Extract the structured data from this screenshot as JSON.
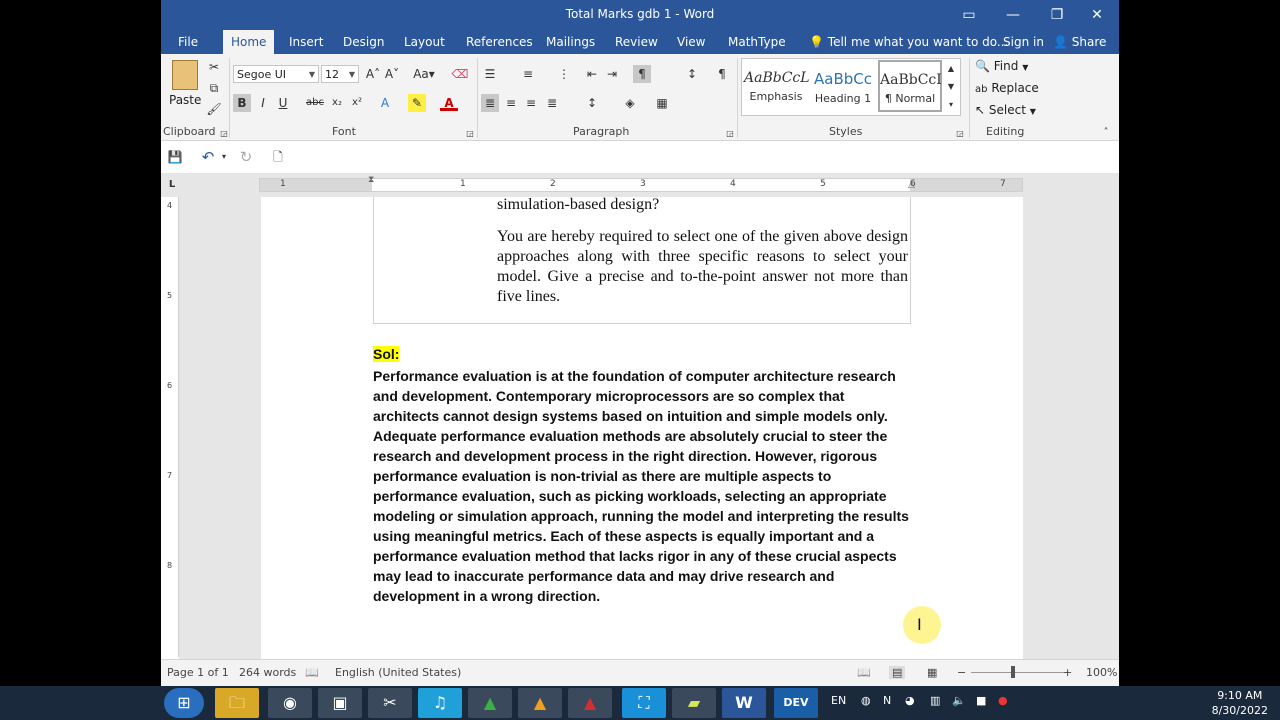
{
  "window": {
    "title": "Total Marks gdb 1 - Word"
  },
  "tabs": [
    "File",
    "Home",
    "Insert",
    "Design",
    "Layout",
    "References",
    "Mailings",
    "Review",
    "View",
    "MathType"
  ],
  "tell_me": "Tell me what you want to do...",
  "sign_in": "Sign in",
  "share": "Share",
  "ribbon": {
    "paste": "Paste",
    "font_name": "Segoe UI",
    "font_size": "12",
    "groups": {
      "clipboard": "Clipboard",
      "font": "Font",
      "paragraph": "Paragraph",
      "styles": "Styles",
      "editing": "Editing"
    },
    "styles": [
      {
        "sample": "AaBbCcL",
        "name": "Emphasis"
      },
      {
        "sample": "AaBbCc",
        "name": "Heading 1"
      },
      {
        "sample": "AaBbCcI",
        "name": "¶ Normal"
      }
    ],
    "editing": {
      "find": "Find",
      "replace": "Replace",
      "select": "Select"
    }
  },
  "ruler": {
    "h_numbers": [
      "1",
      "1",
      "2",
      "3",
      "4",
      "5",
      "6",
      "7"
    ],
    "v_numbers": [
      "4",
      "5",
      "6",
      "7",
      "8"
    ]
  },
  "document": {
    "q_line1": "simulation-based design?",
    "q_para2": "You are hereby required to select one of the given above design approaches along with three specific reasons to select your model. Give a precise and to-the-point answer not more than five lines.",
    "sol_label": "Sol:",
    "answer": "Performance evaluation is at the foundation of computer architecture research and development. Contemporary microprocessors are so complex that architects cannot design systems based on intuition and simple models only. Adequate performance evaluation methods are absolutely crucial to steer the research and development process in the right direction. However, rigorous performance evaluation is non-trivial as there are multiple aspects to performance evaluation, such as picking workloads, selecting an appropriate modeling or simulation approach, running the model and interpreting the results using meaningful metrics. Each of these aspects is equally important and a performance evaluation method that lacks rigor in any of these crucial aspects may lead to inaccurate performance data and may drive research and development in a wrong direction."
  },
  "status": {
    "page": "Page 1 of 1",
    "words": "264 words",
    "language": "English (United States)",
    "zoom": "100%"
  },
  "taskbar": {
    "lang": "EN",
    "time": "9:10 AM",
    "date": "8/30/2022",
    "dev_label": "DEV"
  }
}
